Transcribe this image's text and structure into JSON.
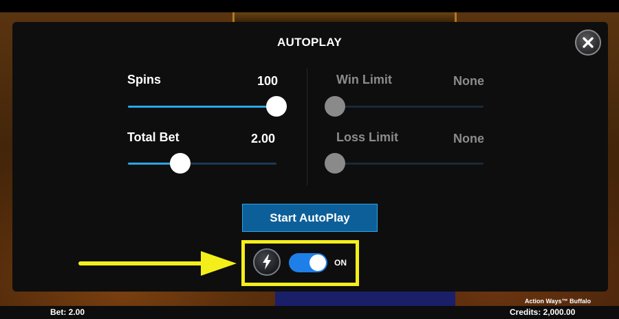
{
  "modal": {
    "title": "AUTOPLAY"
  },
  "spins": {
    "label": "Spins",
    "value": "100",
    "fraction": 1.0
  },
  "total_bet": {
    "label": "Total Bet",
    "value": "2.00",
    "fraction": 0.35
  },
  "win_limit": {
    "label": "Win Limit",
    "value": "None",
    "fraction": 0.0
  },
  "loss_limit": {
    "label": "Loss Limit",
    "value": "None",
    "fraction": 0.0
  },
  "start_button": {
    "label": "Start AutoPlay"
  },
  "turbo": {
    "state_label": "ON",
    "enabled": true
  },
  "footer": {
    "bet": "Bet: 2.00",
    "credits": "Credits: 2,000.00",
    "game_name": "Action Ways™ Buffalo"
  },
  "colors": {
    "accent": "#2aa8e6",
    "button": "#0d5f99",
    "toggle_on": "#1f7fe8",
    "highlight": "#f4ef1a"
  },
  "icons": {
    "close": "close-icon",
    "turbo": "lightning-icon",
    "arrow": "arrow-right-icon"
  }
}
